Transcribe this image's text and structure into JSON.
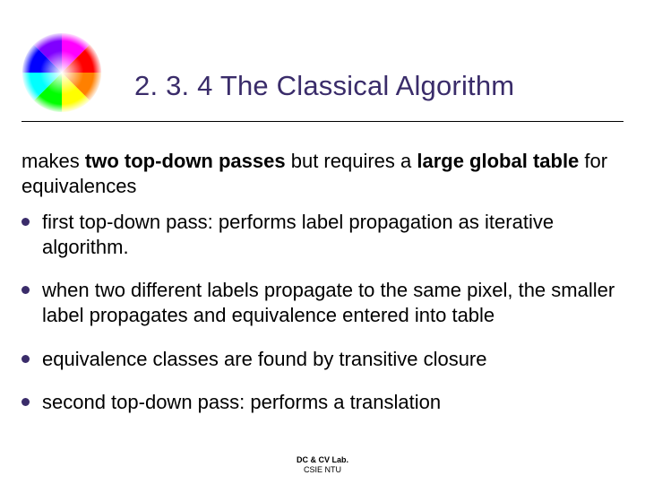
{
  "title": "2. 3. 4 The Classical Algorithm",
  "intro": {
    "seg1": "makes ",
    "bold1": "two top-down passes",
    "seg2": " but requires a ",
    "bold2": "large global table",
    "seg3": " for equivalences"
  },
  "bullets": [
    "first top-down pass: performs label propagation as iterative algorithm.",
    "when two different labels propagate to the same pixel, the smaller label propagates and equivalence entered into table",
    "equivalence classes are found by transitive closure",
    "second top-down pass: performs a translation"
  ],
  "footer": {
    "line1": "DC & CV Lab.",
    "line2": "CSIE NTU"
  }
}
